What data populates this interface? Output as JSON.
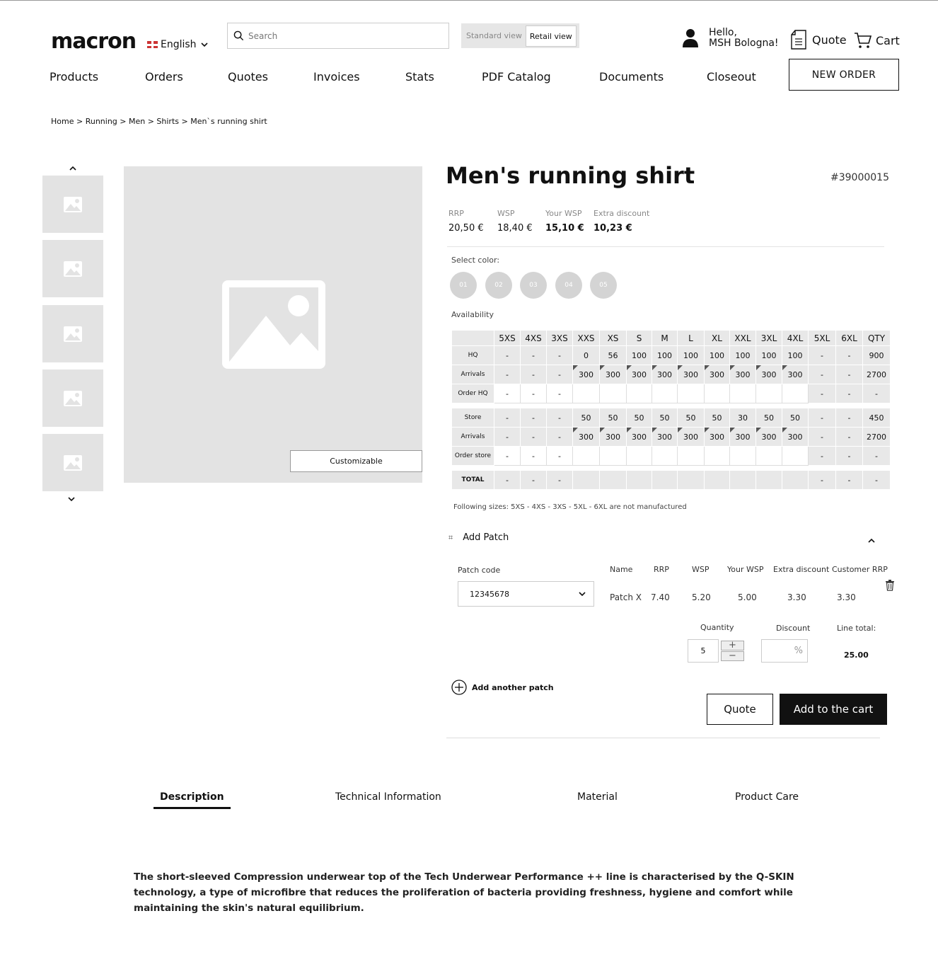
{
  "header": {
    "logo": "macron",
    "language": "English",
    "search_placeholder": "Search",
    "view_standard": "Standard view",
    "view_retail": "Retail view",
    "greeting_line1": "Hello,",
    "greeting_line2": "MSH Bologna!",
    "quote_label": "Quote",
    "cart_label": "Cart"
  },
  "nav": {
    "items": [
      "Products",
      "Orders",
      "Quotes",
      "Invoices",
      "Stats",
      "PDF Catalog",
      "Documents",
      "Closeout"
    ],
    "new_order": "NEW ORDER"
  },
  "breadcrumb": "Home > Running > Men > Shirts > Men`s running shirt",
  "gallery": {
    "customizable_label": "Customizable"
  },
  "product": {
    "title": "Men's running shirt",
    "code": "#39000015",
    "prices": [
      {
        "label": "RRP",
        "value": "20,50 €"
      },
      {
        "label": "WSP",
        "value": "18,40 €"
      },
      {
        "label": "Your WSP",
        "value": "15,10 €"
      },
      {
        "label": "Extra discount",
        "value": "10,23 €"
      }
    ],
    "select_color_label": "Select color:",
    "colors": [
      "01",
      "02",
      "03",
      "04",
      "05"
    ],
    "availability_label": "Availability"
  },
  "availability": {
    "sizes": [
      "5XS",
      "4XS",
      "3XS",
      "XXS",
      "XS",
      "S",
      "M",
      "L",
      "XL",
      "XXL",
      "3XL",
      "4XL",
      "5XL",
      "6XL",
      "QTY"
    ],
    "rows": [
      {
        "label": "HQ",
        "values": [
          "-",
          "-",
          "-",
          "0",
          "56",
          "100",
          "100",
          "100",
          "100",
          "100",
          "100",
          "100",
          "-",
          "-",
          "900"
        ]
      },
      {
        "label": "Arrivals",
        "values": [
          "-",
          "-",
          "-",
          "300",
          "300",
          "300",
          "300",
          "300",
          "300",
          "300",
          "300",
          "300",
          "-",
          "-",
          "2700"
        ]
      },
      {
        "label": "Order HQ",
        "values": [
          "-",
          "-",
          "-",
          "",
          "",
          "",
          "",
          "",
          "",
          "",
          "",
          "",
          "-",
          "-",
          "-"
        ]
      },
      {
        "label": "Store",
        "values": [
          "-",
          "-",
          "-",
          "50",
          "50",
          "50",
          "50",
          "50",
          "50",
          "30",
          "50",
          "50",
          "-",
          "-",
          "450"
        ]
      },
      {
        "label": "Arrivals",
        "values": [
          "-",
          "-",
          "-",
          "300",
          "300",
          "300",
          "300",
          "300",
          "300",
          "300",
          "300",
          "300",
          "-",
          "-",
          "2700"
        ]
      },
      {
        "label": "Order store",
        "values": [
          "-",
          "-",
          "-",
          "",
          "",
          "",
          "",
          "",
          "",
          "",
          "",
          "",
          "-",
          "-",
          "-"
        ]
      },
      {
        "label": "TOTAL",
        "values": [
          "-",
          "-",
          "-",
          "",
          "",
          "",
          "",
          "",
          "",
          "",
          "",
          "",
          "-",
          "-",
          "-"
        ]
      }
    ],
    "note": "Following sizes: 5XS - 4XS - 3XS - 5XL - 6XL are not manufactured"
  },
  "patch": {
    "title": "Add Patch",
    "code_label": "Patch code",
    "code_value": "12345678",
    "cols": [
      "Name",
      "RRP",
      "WSP",
      "Your WSP",
      "Extra discount",
      "Customer RRP"
    ],
    "vals": [
      "Patch X",
      "7.40",
      "5.20",
      "5.00",
      "3.30",
      "3.30"
    ],
    "quantity_label": "Quantity",
    "quantity_value": "5",
    "discount_label": "Discount",
    "discount_unit": "%",
    "line_total_label": "Line total:",
    "line_total_value": "25.00",
    "add_another": "Add another patch"
  },
  "actions": {
    "quote": "Quote",
    "add_to_cart": "Add to the cart"
  },
  "tabs": [
    "Description",
    "Technical Information",
    "Material",
    "Product Care"
  ],
  "description": "The short-sleeved Compression underwear top of the Tech Underwear Performance ++ line is characterised by the Q-SKIN technology, a type of microfibre that reduces the proliferation of bacteria providing freshness, hygiene and comfort while maintaining the skin's natural equilibrium."
}
